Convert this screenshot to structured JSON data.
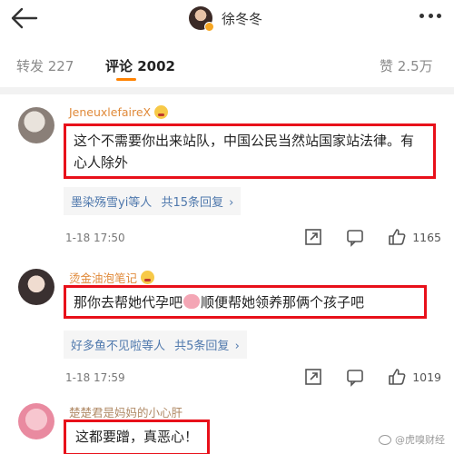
{
  "header": {
    "title": "徐冬冬"
  },
  "tabs": [
    {
      "label": "转发 227"
    },
    {
      "label": "评论 2002"
    },
    {
      "label": "赞 2.5万"
    }
  ],
  "comments": [
    {
      "user": "JeneuxlefaireX",
      "text": "这个不需要你出来站队，中国公民当然站国家站法律。有心人除外",
      "reply_names": "墨染殇雪yi等人",
      "reply_count": "共15条回复",
      "time": "1-18 17:50",
      "likes": "1165"
    },
    {
      "user": "烫金油泡笔记",
      "text_before": "那你去帮她代孕吧",
      "text_after": "顺便帮她领养那俩个孩子吧",
      "reply_names": "好多鱼不见啦等人",
      "reply_count": "共5条回复",
      "time": "1-18 17:59",
      "likes": "1019"
    },
    {
      "user": "楚楚君是妈妈的小心肝",
      "text": "这都要蹭，真恶心！"
    }
  ],
  "watermark": "@虎嗅财经",
  "colors": {
    "accent": "#ff8200",
    "highlight_border": "#e8101a",
    "link": "#5079ad",
    "username": "#e08a3a"
  }
}
